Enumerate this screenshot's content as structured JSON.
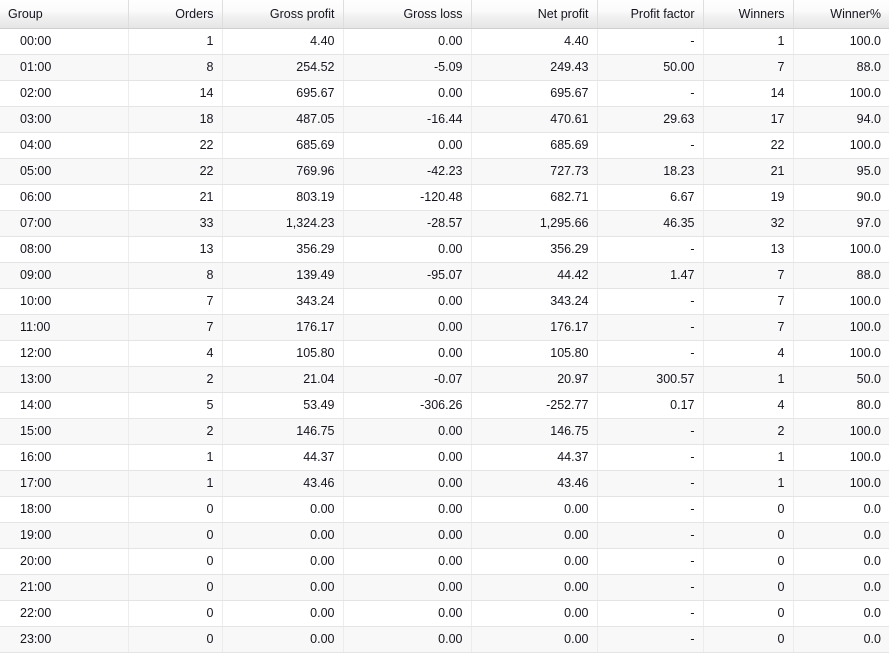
{
  "table": {
    "columns": [
      {
        "key": "group",
        "label": "Group",
        "align": "left"
      },
      {
        "key": "orders",
        "label": "Orders",
        "align": "right"
      },
      {
        "key": "gross_profit",
        "label": "Gross profit",
        "align": "right"
      },
      {
        "key": "gross_loss",
        "label": "Gross loss",
        "align": "right"
      },
      {
        "key": "net_profit",
        "label": "Net profit",
        "align": "right"
      },
      {
        "key": "profit_factor",
        "label": "Profit factor",
        "align": "right"
      },
      {
        "key": "winners",
        "label": "Winners",
        "align": "right"
      },
      {
        "key": "winner_pct",
        "label": "Winner%",
        "align": "right"
      }
    ],
    "rows": [
      [
        "00:00",
        "1",
        "4.40",
        "0.00",
        "4.40",
        "-",
        "1",
        "100.0"
      ],
      [
        "01:00",
        "8",
        "254.52",
        "-5.09",
        "249.43",
        "50.00",
        "7",
        "88.0"
      ],
      [
        "02:00",
        "14",
        "695.67",
        "0.00",
        "695.67",
        "-",
        "14",
        "100.0"
      ],
      [
        "03:00",
        "18",
        "487.05",
        "-16.44",
        "470.61",
        "29.63",
        "17",
        "94.0"
      ],
      [
        "04:00",
        "22",
        "685.69",
        "0.00",
        "685.69",
        "-",
        "22",
        "100.0"
      ],
      [
        "05:00",
        "22",
        "769.96",
        "-42.23",
        "727.73",
        "18.23",
        "21",
        "95.0"
      ],
      [
        "06:00",
        "21",
        "803.19",
        "-120.48",
        "682.71",
        "6.67",
        "19",
        "90.0"
      ],
      [
        "07:00",
        "33",
        "1,324.23",
        "-28.57",
        "1,295.66",
        "46.35",
        "32",
        "97.0"
      ],
      [
        "08:00",
        "13",
        "356.29",
        "0.00",
        "356.29",
        "-",
        "13",
        "100.0"
      ],
      [
        "09:00",
        "8",
        "139.49",
        "-95.07",
        "44.42",
        "1.47",
        "7",
        "88.0"
      ],
      [
        "10:00",
        "7",
        "343.24",
        "0.00",
        "343.24",
        "-",
        "7",
        "100.0"
      ],
      [
        "11:00",
        "7",
        "176.17",
        "0.00",
        "176.17",
        "-",
        "7",
        "100.0"
      ],
      [
        "12:00",
        "4",
        "105.80",
        "0.00",
        "105.80",
        "-",
        "4",
        "100.0"
      ],
      [
        "13:00",
        "2",
        "21.04",
        "-0.07",
        "20.97",
        "300.57",
        "1",
        "50.0"
      ],
      [
        "14:00",
        "5",
        "53.49",
        "-306.26",
        "-252.77",
        "0.17",
        "4",
        "80.0"
      ],
      [
        "15:00",
        "2",
        "146.75",
        "0.00",
        "146.75",
        "-",
        "2",
        "100.0"
      ],
      [
        "16:00",
        "1",
        "44.37",
        "0.00",
        "44.37",
        "-",
        "1",
        "100.0"
      ],
      [
        "17:00",
        "1",
        "43.46",
        "0.00",
        "43.46",
        "-",
        "1",
        "100.0"
      ],
      [
        "18:00",
        "0",
        "0.00",
        "0.00",
        "0.00",
        "-",
        "0",
        "0.0"
      ],
      [
        "19:00",
        "0",
        "0.00",
        "0.00",
        "0.00",
        "-",
        "0",
        "0.0"
      ],
      [
        "20:00",
        "0",
        "0.00",
        "0.00",
        "0.00",
        "-",
        "0",
        "0.0"
      ],
      [
        "21:00",
        "0",
        "0.00",
        "0.00",
        "0.00",
        "-",
        "0",
        "0.0"
      ],
      [
        "22:00",
        "0",
        "0.00",
        "0.00",
        "0.00",
        "-",
        "0",
        "0.0"
      ],
      [
        "23:00",
        "0",
        "0.00",
        "0.00",
        "0.00",
        "-",
        "0",
        "0.0"
      ]
    ]
  },
  "colors": {
    "header_gradient_top": "#fefefe",
    "header_gradient_bottom": "#e6e6e6",
    "row_even_bg": "#ffffff",
    "row_odd_bg": "#f8f8f8",
    "text": "#15151f",
    "grid_line": "#e4e4e4"
  }
}
